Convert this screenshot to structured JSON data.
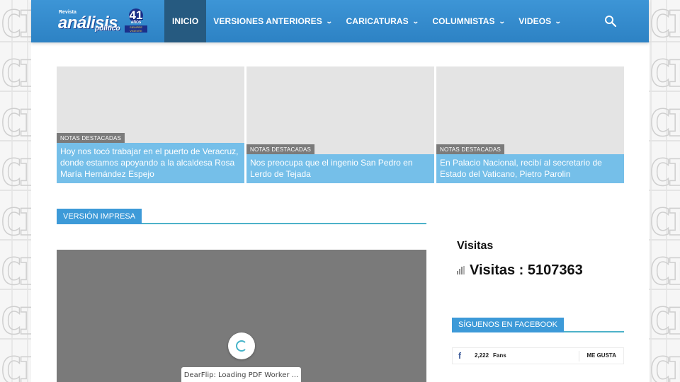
{
  "header": {
    "logo": {
      "small": "Revista",
      "main": "análisis",
      "sub": "político",
      "badge_number": "41",
      "badge_anos": "AÑOS",
      "badge_tag": "SIEMPRE VIGENTE"
    },
    "nav": [
      {
        "label": "INICIO",
        "active": true
      },
      {
        "label": "VERSIONES ANTERIORES",
        "chevron": "chevron-down-icon"
      },
      {
        "label": "CARICATURAS",
        "chevron": "chevron-down-icon"
      },
      {
        "label": "COLUMNISTAS",
        "chevron": "chevron-down-icon"
      },
      {
        "label": "VIDEOS",
        "chevron": "chevron-down-icon"
      }
    ],
    "search_icon": "search-icon",
    "colors": {
      "bar": "#3d95d6",
      "active": "#265a80"
    }
  },
  "featured": [
    {
      "category": "NOTAS DESTACADAS",
      "title": "Hoy nos tocó trabajar en el puerto de Veracruz, donde estamos apoyando a la alcaldesa Rosa María Hernández Espejo"
    },
    {
      "category": "NOTAS DESTACADAS",
      "title": "Nos preocupa que el ingenio San Pedro en Lerdo de Tejada"
    },
    {
      "category": "NOTAS DESTACADAS",
      "title": "En Palacio Nacional, recibí al secretario de Estado del Vaticano, Pietro Parolin"
    }
  ],
  "print_section": {
    "title": "VERSIÓN IMPRESA",
    "viewer_status": "DearFlip: Loading PDF Worker ..."
  },
  "sidebar": {
    "visitas_title": "Visitas",
    "visitas_count": "Visitas : 5107363",
    "facebook_title": "SÍGUENOS EN FACEBOOK",
    "fb_icon": "facebook-icon",
    "fans_count": "2,222",
    "fans_label": "Fans",
    "like_label": "ME GUSTA"
  }
}
